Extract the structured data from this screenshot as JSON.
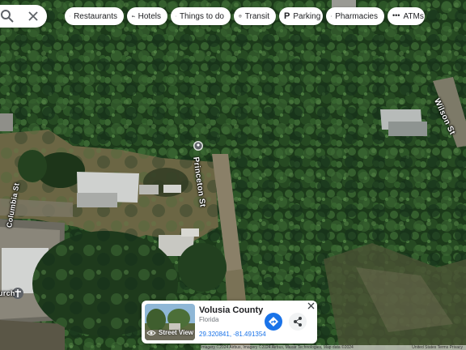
{
  "search": {
    "search_icon": "search-icon",
    "close_icon": "close-icon"
  },
  "chips": [
    {
      "label": "Restaurants",
      "icon": "fork-knife-icon"
    },
    {
      "label": "Hotels",
      "icon": "bed-icon"
    },
    {
      "label": "Things to do",
      "icon": "camera-icon"
    },
    {
      "label": "Transit",
      "icon": "train-icon"
    },
    {
      "label": "Parking",
      "icon": "parking-icon"
    },
    {
      "label": "Pharmacies",
      "icon": "pharmacy-icon"
    },
    {
      "label": "ATMs",
      "icon": "atm-icon"
    }
  ],
  "map": {
    "streets": [
      {
        "label": "Princeton St"
      },
      {
        "label": "Wilson St"
      },
      {
        "label": "Columbia St"
      }
    ],
    "poi_partial_label": "urch",
    "colors": {
      "tree_dark": "#1f3d1d",
      "tree_mid": "#2f5a2a",
      "clearing": "#6f6a47",
      "road": "#8a8068"
    }
  },
  "card": {
    "title": "Volusia County",
    "subtitle": "Florida",
    "coords": "29.320841, -81.491354",
    "street_view_label": "Street View",
    "directions_icon": "directions-icon",
    "share_icon": "share-icon",
    "close_icon": "close-icon"
  },
  "attribution": {
    "text": "Imagery ©2024 Airbus, Imagery ©2024 Airbus, Maxar Technologies, Map data ©2024",
    "right": "United States   Terms   Privacy"
  },
  "accent": "#1a73e8"
}
